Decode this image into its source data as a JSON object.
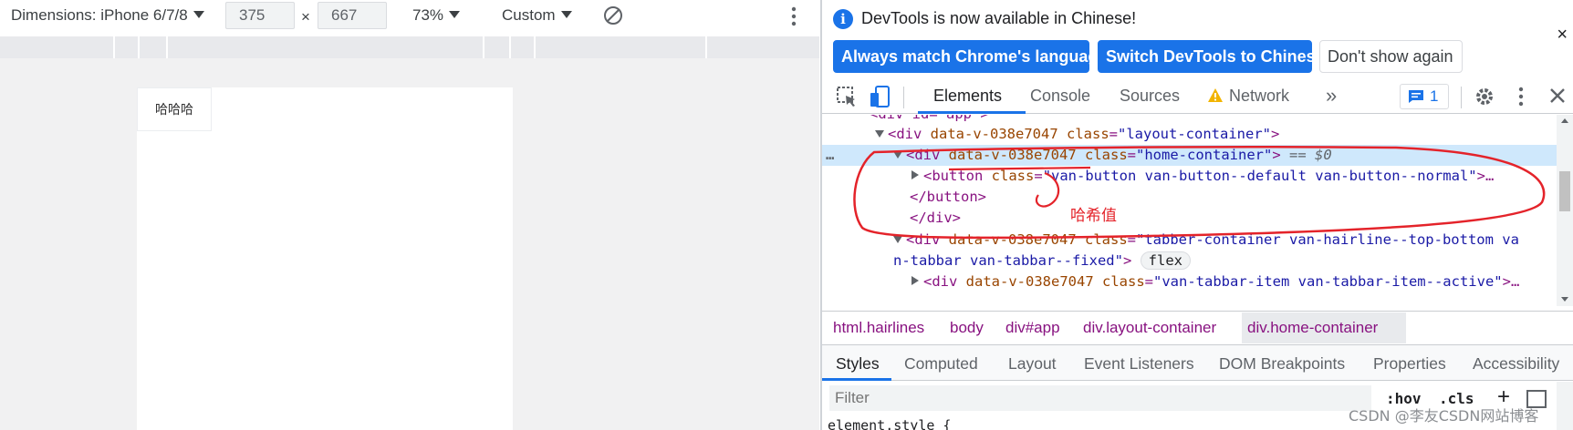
{
  "device_toolbar": {
    "dimensions_label": "Dimensions: iPhone 6/7/8",
    "width": "375",
    "times": "×",
    "height": "667",
    "zoom": "73%",
    "throttle": "Custom"
  },
  "device_content": {
    "button_label": "哈哈哈"
  },
  "infobar": {
    "message": "DevTools is now available in Chinese!",
    "btn_match": "Always match Chrome's language",
    "btn_switch": "Switch DevTools to Chinese",
    "btn_dismiss": "Don't show again",
    "close": "×"
  },
  "tabs": {
    "elements": "Elements",
    "console": "Console",
    "sources": "Sources",
    "network": "Network",
    "more": "»",
    "issues_count": "1"
  },
  "tree": {
    "row0": "<div id=\"app\">",
    "row1": {
      "tag_open": "<div",
      "attr1": "data-v-038e7047",
      "attr2_name": "class",
      "attr2_val": "\"layout-container\"",
      "tag_close": ">"
    },
    "row2": {
      "dots": "…",
      "tag_open": "<div",
      "attr1": "data-v-038e7047",
      "attr2_name": "class",
      "attr2_val": "\"home-container\"",
      "tag_close": ">",
      "marker": "== $0"
    },
    "row3": {
      "tag_open": "<button",
      "attr_name": "class",
      "attr_val": "\"van-button van-button--default van-button--normal\"",
      "tail": ">…"
    },
    "row4": "</button>",
    "row5": "</div>",
    "row6": {
      "tag_open": "<div",
      "attr1": "data-v-038e7047",
      "attr2_name": "class",
      "attr2_val": "\"tabber-container van-hairline--top-bottom va"
    },
    "row7": {
      "cont": "n-tabbar van-tabbar--fixed\"",
      "tag_close": ">",
      "pill": "flex"
    },
    "row8": {
      "tag_open": "<div",
      "attr1": "data-v-038e7047",
      "attr2_name": "class",
      "attr2_val": "\"van-tabbar-item van-tabbar-item--active\"",
      "tail": ">…"
    }
  },
  "breadcrumbs": [
    "html.hairlines",
    "body",
    "div#app",
    "div.layout-container",
    "div.home-container"
  ],
  "style_tabs": [
    "Styles",
    "Computed",
    "Layout",
    "Event Listeners",
    "DOM Breakpoints",
    "Properties",
    "Accessibility"
  ],
  "filter": {
    "placeholder": "Filter",
    "hov": ":hov",
    "cls": ".cls",
    "plus": "+"
  },
  "element_style": "element.style {",
  "annotation": {
    "text": "哈希值",
    "color": "#e4232a"
  },
  "watermark": "CSDN @李友CSDN网站博客",
  "colors": {
    "accent": "#1a73e8",
    "tag": "#881280",
    "attr_name": "#994500",
    "attr_value": "#1a1aa6",
    "selected_row": "#cfe8fc"
  }
}
